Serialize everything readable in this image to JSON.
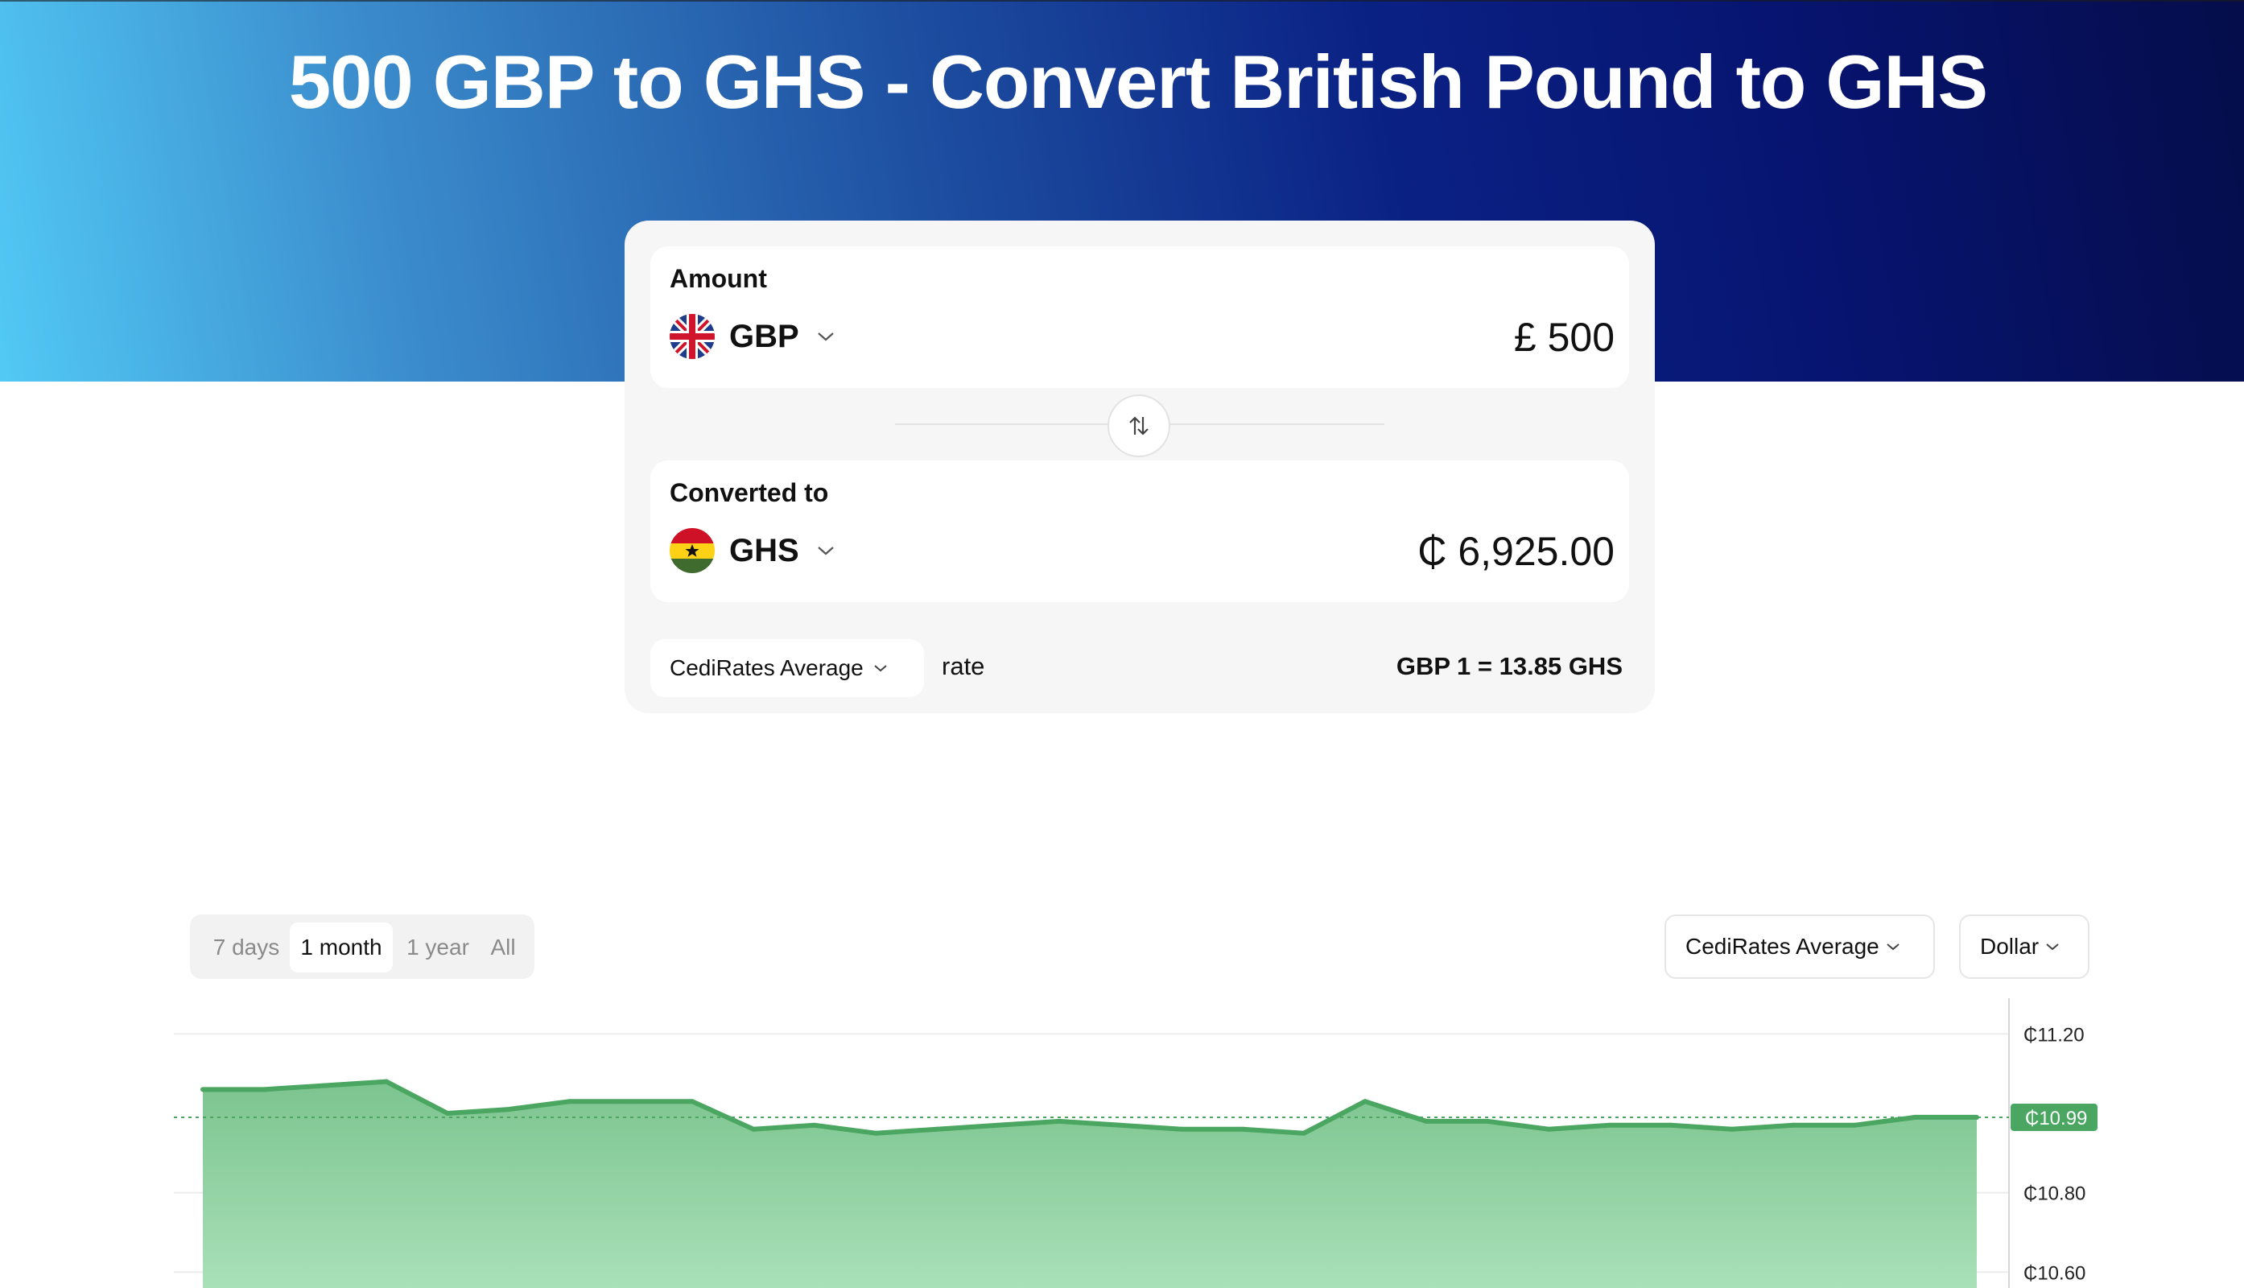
{
  "page": {
    "title": "500 GBP to GHS - Convert British Pound to GHS"
  },
  "converter": {
    "amount_label": "Amount",
    "from_currency": "GBP",
    "from_flag_icon": "uk-flag-icon",
    "amount_value": "£ 500",
    "converted_label": "Converted to",
    "to_currency": "GHS",
    "to_flag_icon": "ghana-flag-icon",
    "converted_value": "₵ 6,925.00",
    "source_selected": "CediRates Average",
    "rate_word": "rate",
    "rate_text": "GBP 1 = 13.85 GHS"
  },
  "chart_controls": {
    "ranges": [
      "7 days",
      "1 month",
      "1 year",
      "All"
    ],
    "active_range": "1 month",
    "source_selected": "CediRates Average",
    "base_selected": "Dollar"
  },
  "colors": {
    "accent_green": "#4aa661",
    "area_fill_top": "#7cc48f",
    "area_fill_bottom": "#a9e0b8"
  },
  "chart_data": {
    "type": "area",
    "title": "",
    "xlabel": "",
    "ylabel": "",
    "y_ticks": [
      "₵11.20",
      "₵10.80",
      "₵10.60"
    ],
    "current_value_label": "₵10.99",
    "current_value": 10.99,
    "ylim": [
      10.56,
      11.29
    ],
    "grid": true,
    "series": [
      {
        "values": [
          11.06,
          11.06,
          11.07,
          11.08,
          11.0,
          11.01,
          11.03,
          11.03,
          11.03,
          10.96,
          10.97,
          10.95,
          10.96,
          10.97,
          10.98,
          10.97,
          10.96,
          10.96,
          10.95,
          11.03,
          10.98,
          10.98,
          10.96,
          10.97,
          10.97,
          10.96,
          10.97,
          10.97,
          10.99,
          10.99
        ]
      }
    ]
  }
}
